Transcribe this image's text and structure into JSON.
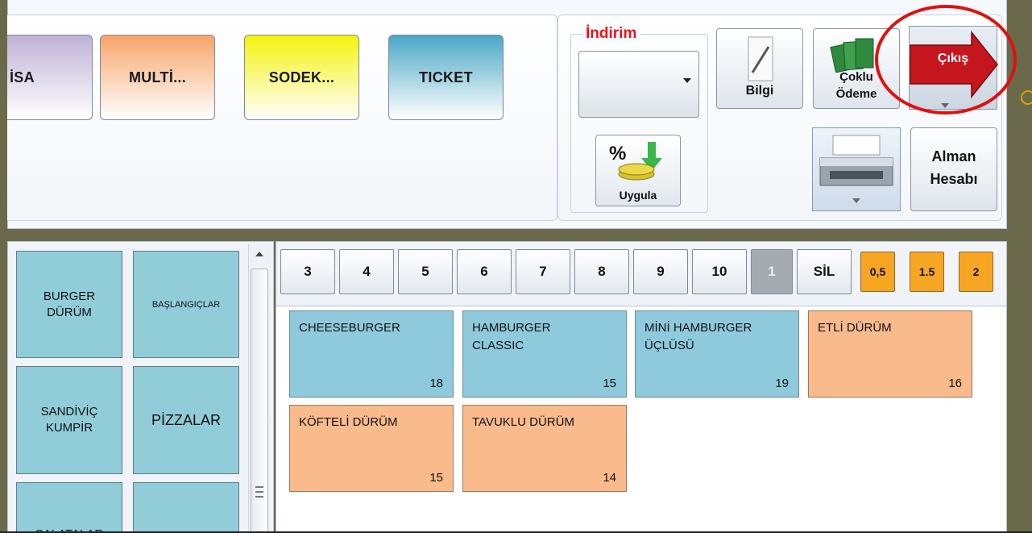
{
  "payment_buttons": {
    "visa": "İSA",
    "multi": "MULTİ...",
    "sodek": "SODEK...",
    "ticket": "TICKET"
  },
  "discount": {
    "label": "İndirim",
    "selected_value": "",
    "apply_label": "Uygula",
    "apply_icon_text": "%"
  },
  "toolbar": {
    "info_label": "Bilgi",
    "multipay_line1": "Çoklu",
    "multipay_line2": "Ödeme",
    "exit_label": "Çıkış",
    "account_line1": "Alman",
    "account_line2": "Hesabı"
  },
  "categories": [
    {
      "label": "BURGER\nDÜRÜM"
    },
    {
      "label": "BAŞLANGIÇLAR"
    },
    {
      "label": "SANDİVİÇ\nKUMPİR"
    },
    {
      "label": "PİZZALAR"
    },
    {
      "label": "SALATALAR"
    },
    {
      "label": ""
    }
  ],
  "quantity_buttons": [
    "3",
    "4",
    "5",
    "6",
    "7",
    "8",
    "9",
    "10",
    "1",
    "SİL"
  ],
  "multiplier_buttons": [
    "0,5",
    "1.5",
    "2"
  ],
  "products": [
    {
      "name": "CHEESEBURGER",
      "price": "18"
    },
    {
      "name": "HAMBURGER\nCLASSIC",
      "price": "15"
    },
    {
      "name": "MİNİ HAMBURGER\nÜÇLÜSÜ",
      "price": "19"
    },
    {
      "name": "ETLİ DÜRÜM",
      "price": "16"
    },
    {
      "name": "KÖFTELİ DÜRÜM",
      "price": "15"
    },
    {
      "name": "TAVUKLU DÜRÜM",
      "price": "14"
    }
  ],
  "colors": {
    "category": "#91ccd9",
    "product_blue": "#8ecadc",
    "product_peach": "#f9bb8c",
    "multiplier": "#f7a624",
    "discount_label": "#e8141e",
    "exit_red": "#c4161c",
    "highlight_circle": "#e01010"
  }
}
